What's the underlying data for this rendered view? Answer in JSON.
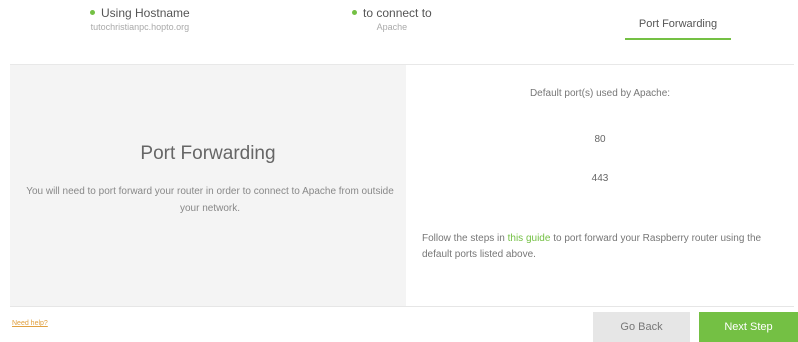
{
  "banner": {
    "text": ""
  },
  "steps": [
    {
      "title": "Using Hostname",
      "sub": "tutochristianpc.hopto.org",
      "done": true
    },
    {
      "title": "to connect to",
      "sub": "Apache",
      "done": true
    },
    {
      "title": "Port Forwarding",
      "active": true
    }
  ],
  "left": {
    "title": "Port Forwarding",
    "description": "You will need to port forward your router in order to connect to Apache from outside your network."
  },
  "right": {
    "ports_label": "Default port(s) used by Apache:",
    "ports": [
      "80",
      "443"
    ],
    "follow_before": "Follow the steps in ",
    "follow_link": "this guide",
    "follow_after": " to port forward your Raspberry router using the default ports listed above."
  },
  "footer": {
    "need_help": "Need help?",
    "back_label": "Go Back",
    "next_label": "Next Step"
  },
  "colors": {
    "accent": "#74c044",
    "banner": "#2a3fd8"
  }
}
